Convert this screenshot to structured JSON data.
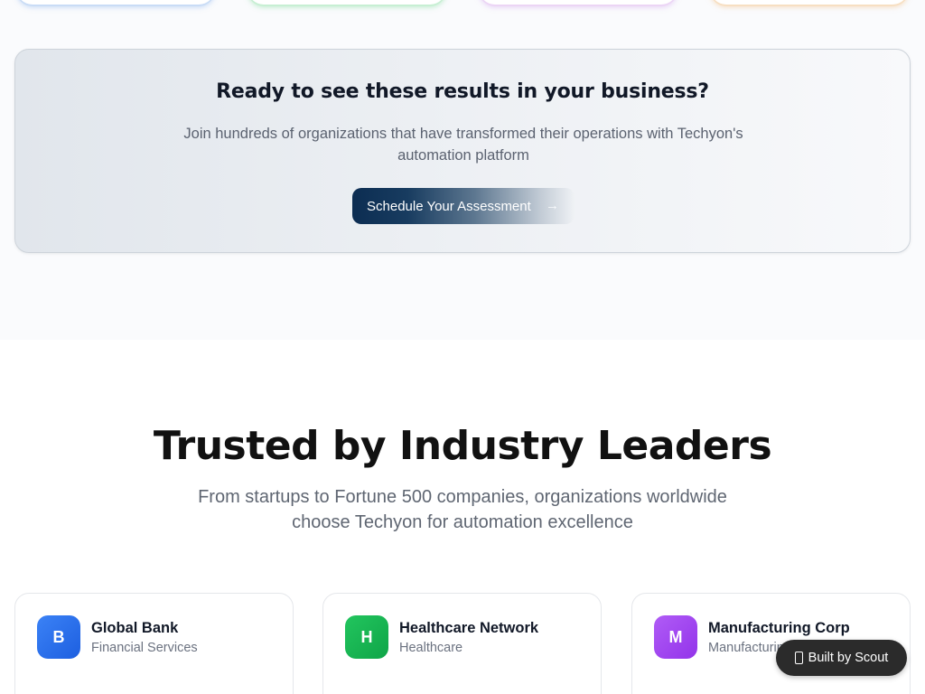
{
  "cta": {
    "title": "Ready to see these results in your business?",
    "subtitle": "Join hundreds of organizations that have transformed their operations with Techyon's automation platform",
    "button_label": "Schedule Your Assessment",
    "button_icon": "arrow-right-icon"
  },
  "trusted": {
    "title": "Trusted by Industry Leaders",
    "subtitle": "From startups to Fortune 500 companies, organizations worldwide choose Techyon for automation excellence"
  },
  "companies": [
    {
      "initial": "B",
      "name": "Global Bank",
      "industry": "Financial Services",
      "color": "#2f74f2"
    },
    {
      "initial": "H",
      "name": "Healthcare Network",
      "industry": "Healthcare",
      "color": "#16b853"
    },
    {
      "initial": "M",
      "name": "Manufacturing Corp",
      "industry": "Manufacturing",
      "color": "#a347f0"
    }
  ],
  "badge": {
    "label": "Built by Scout",
    "icon": "scout-icon"
  },
  "colors": {
    "cta_button": "#0c2d52",
    "top_card_accents": [
      "#93baf0",
      "#86dea0",
      "#d6aaf0",
      "#f6c48c"
    ]
  }
}
